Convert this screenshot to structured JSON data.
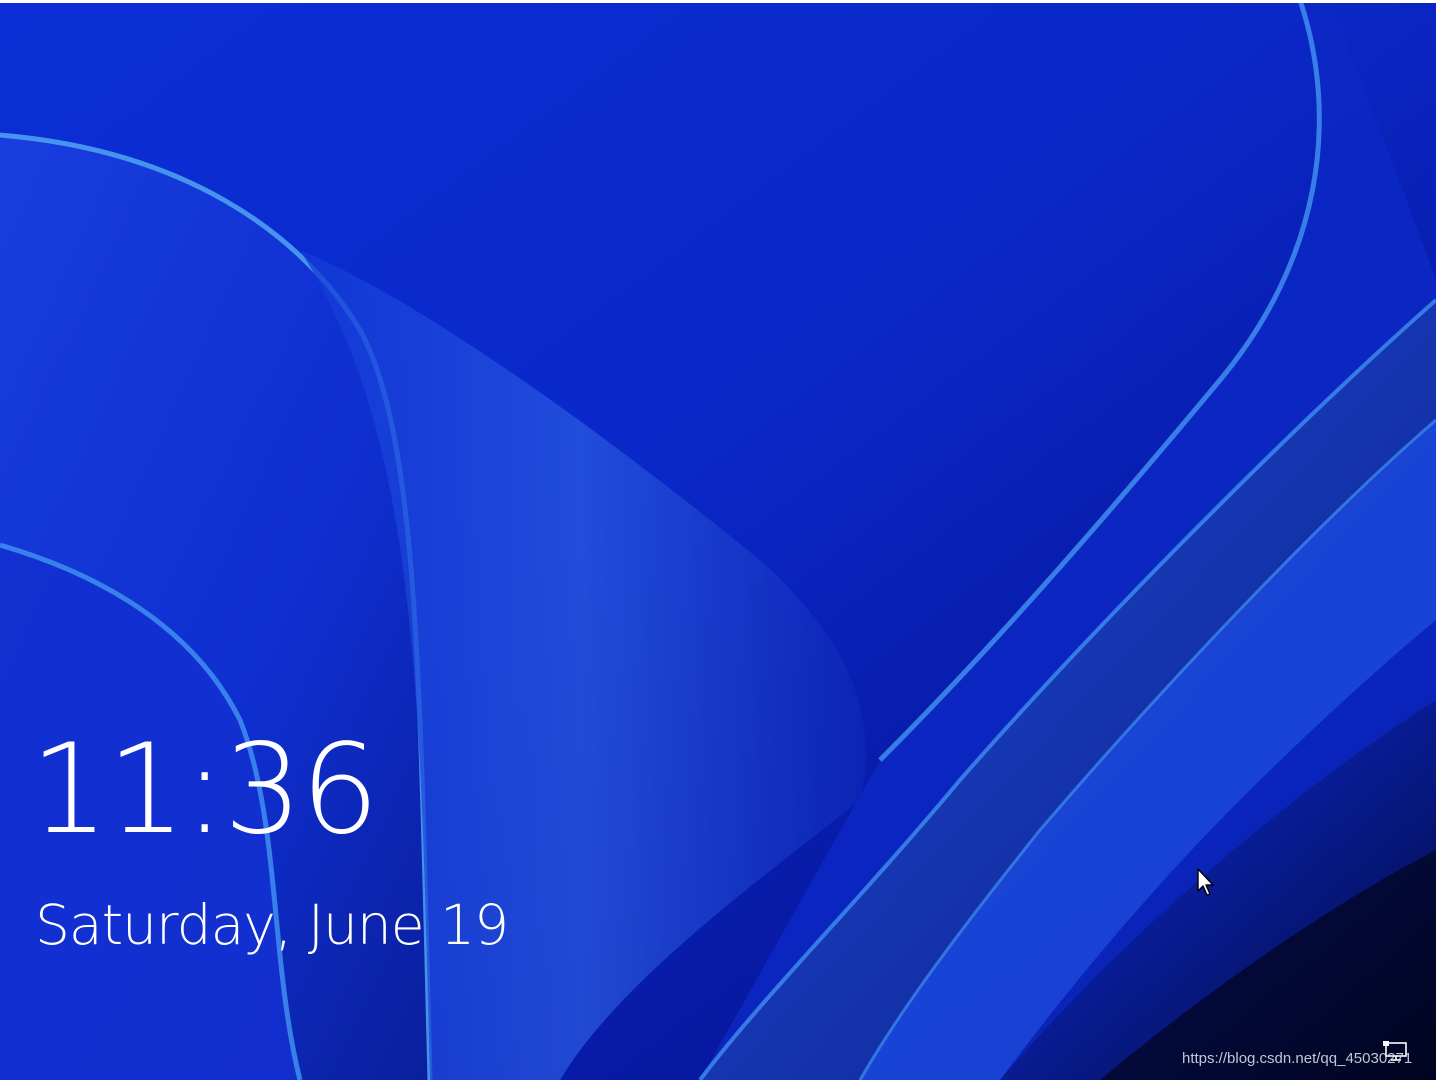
{
  "lock_screen": {
    "time": "11:36",
    "date": "Saturday, June 19"
  },
  "watermark": {
    "text": "https://blog.csdn.net/qq_45030271"
  },
  "icons": {
    "cursor": "mouse-pointer-icon",
    "tray": "network-icon"
  },
  "colors": {
    "background_top": "#0a2bd6",
    "background_deep": "#040a55",
    "ribbon_highlight": "#4aa0f0",
    "text": "#ffffff"
  }
}
